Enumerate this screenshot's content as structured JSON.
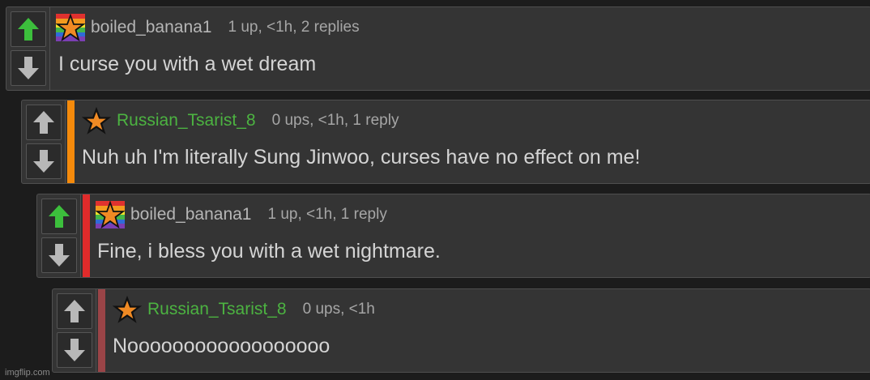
{
  "comments": [
    {
      "username": "boiled_banana1",
      "meta": "1 up, <1h, 2 replies",
      "text": "I curse you with a wet dream",
      "avatar": "rainbow-star-icon",
      "up_active": true,
      "name_color": "#b6b6b6",
      "bar_color": null
    },
    {
      "username": "Russian_Tsarist_8",
      "meta": "0 ups, <1h, 1 reply",
      "text": "Nuh uh I'm literally Sung Jinwoo, curses have no effect on me!",
      "avatar": "star-icon",
      "up_active": false,
      "name_color": "#4cb341",
      "bar_color": "#f58a0b"
    },
    {
      "username": "boiled_banana1",
      "meta": "1 up, <1h, 1 reply",
      "text": "Fine, i bless you with a wet nightmare.",
      "avatar": "rainbow-star-icon",
      "up_active": true,
      "name_color": "#b6b6b6",
      "bar_color": "#e02b2b"
    },
    {
      "username": "Russian_Tsarist_8",
      "meta": "0 ups, <1h",
      "text": "Noooooooooooooooooo",
      "avatar": "star-icon",
      "up_active": false,
      "name_color": "#4cb341",
      "bar_color": "#9a4447"
    }
  ],
  "watermark": "imgflip.com",
  "colors": {
    "vote_active": "#3cbf3c",
    "vote_inactive": "#b8b8b8",
    "background": "#1c1c1c",
    "panel": "#343434"
  }
}
